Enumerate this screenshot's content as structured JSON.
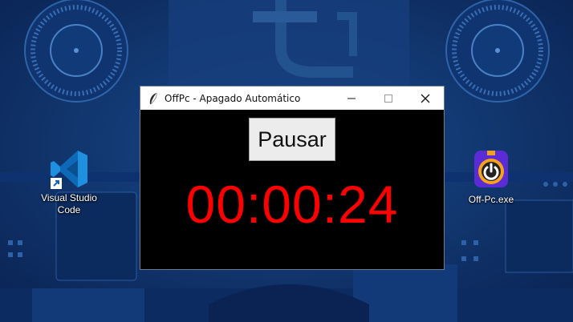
{
  "desktop": {
    "icons": [
      {
        "label": "Visual Studio Code",
        "icon": "vscode-icon"
      },
      {
        "label": "Off-Pc.exe",
        "icon": "power-stopwatch-icon"
      }
    ]
  },
  "window": {
    "title": "OffPc - Apagado Automático",
    "app_icon": "feather-icon",
    "controls": [
      "minimize-icon",
      "maximize-icon",
      "close-icon"
    ],
    "pause_label": "Pausar",
    "timer": "00:00:24",
    "timer_color": "#ff0000",
    "background_color": "#000000"
  }
}
